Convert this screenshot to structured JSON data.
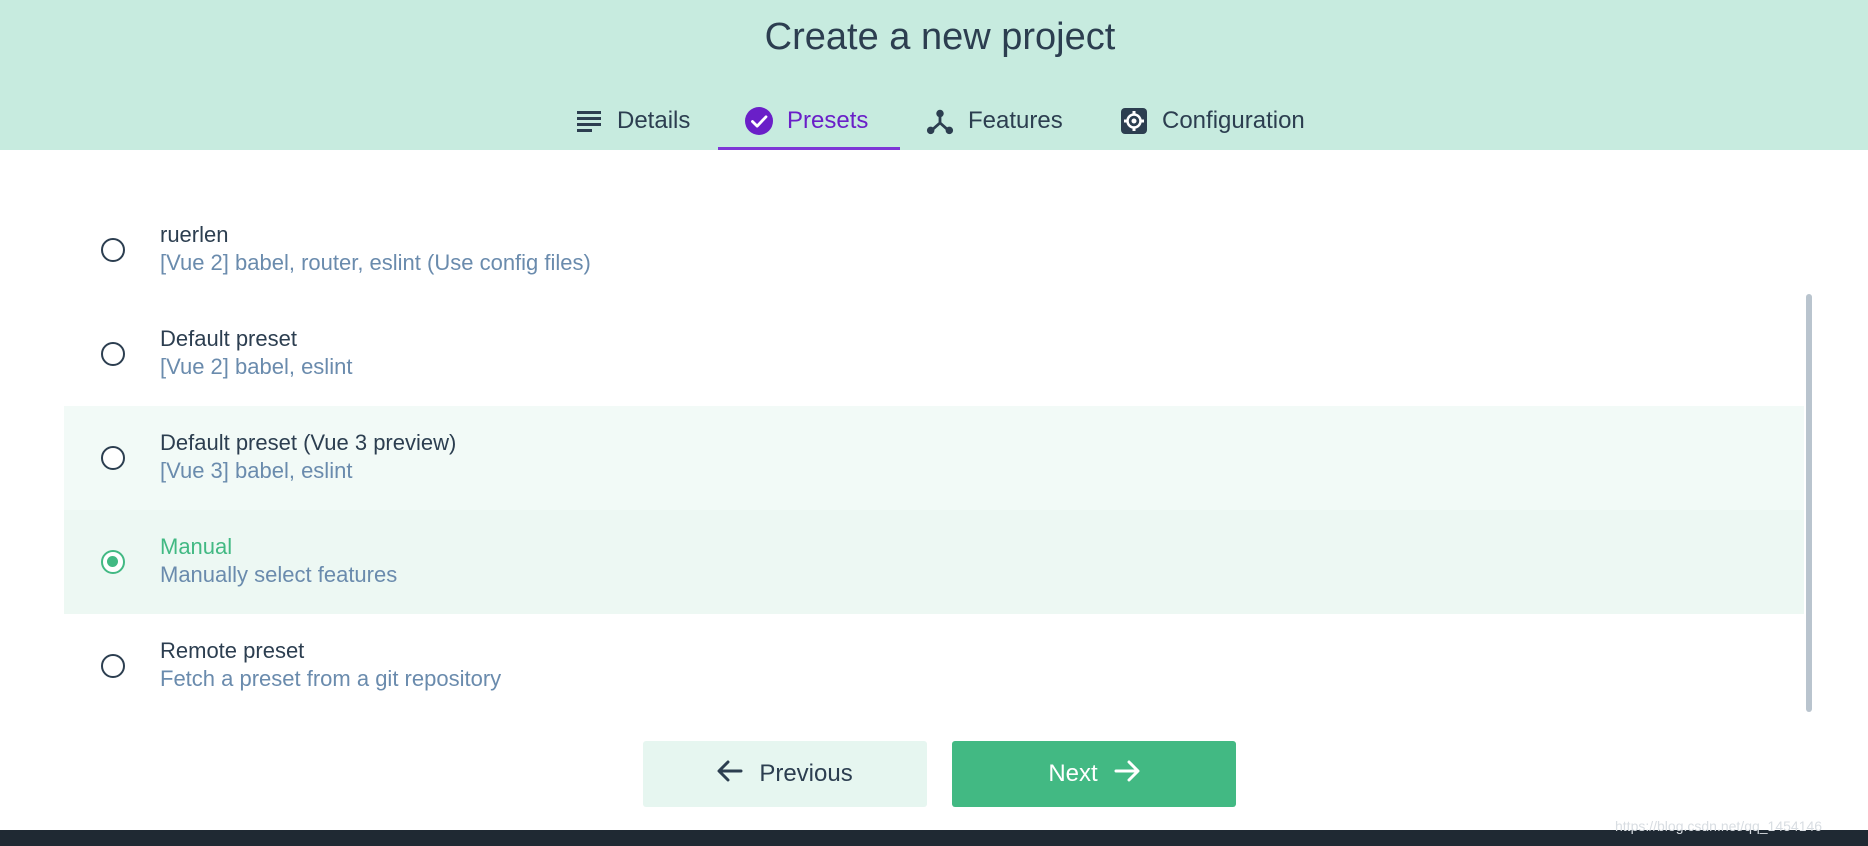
{
  "header": {
    "title": "Create a new project",
    "background": "#c7ebdf"
  },
  "tabs": [
    {
      "label": "Details",
      "icon": "list-icon",
      "active": false
    },
    {
      "label": "Presets",
      "icon": "check-circle-icon",
      "active": true
    },
    {
      "label": "Features",
      "icon": "fork-icon",
      "active": false
    },
    {
      "label": "Configuration",
      "icon": "gear-icon",
      "active": false
    }
  ],
  "presets": [
    {
      "name": "ruerlen",
      "description": "[Vue 2] babel, router, eslint (Use config files)",
      "selected": false
    },
    {
      "name": "Default preset",
      "description": "[Vue 2] babel, eslint",
      "selected": false
    },
    {
      "name": "Default preset (Vue 3 preview)",
      "description": "[Vue 3] babel, eslint",
      "selected": false
    },
    {
      "name": "Manual",
      "description": "Manually select features",
      "selected": true
    },
    {
      "name": "Remote preset",
      "description": "Fetch a preset from a git repository",
      "selected": false
    }
  ],
  "buttons": {
    "previous_label": "Previous",
    "next_label": "Next"
  },
  "colors": {
    "accent": "#42b983",
    "active_tab": "#6a1fc8",
    "text": "#2c3e50",
    "muted": "#6a8bad"
  },
  "watermark": "https://blog.csdn.net/qq_1454146"
}
